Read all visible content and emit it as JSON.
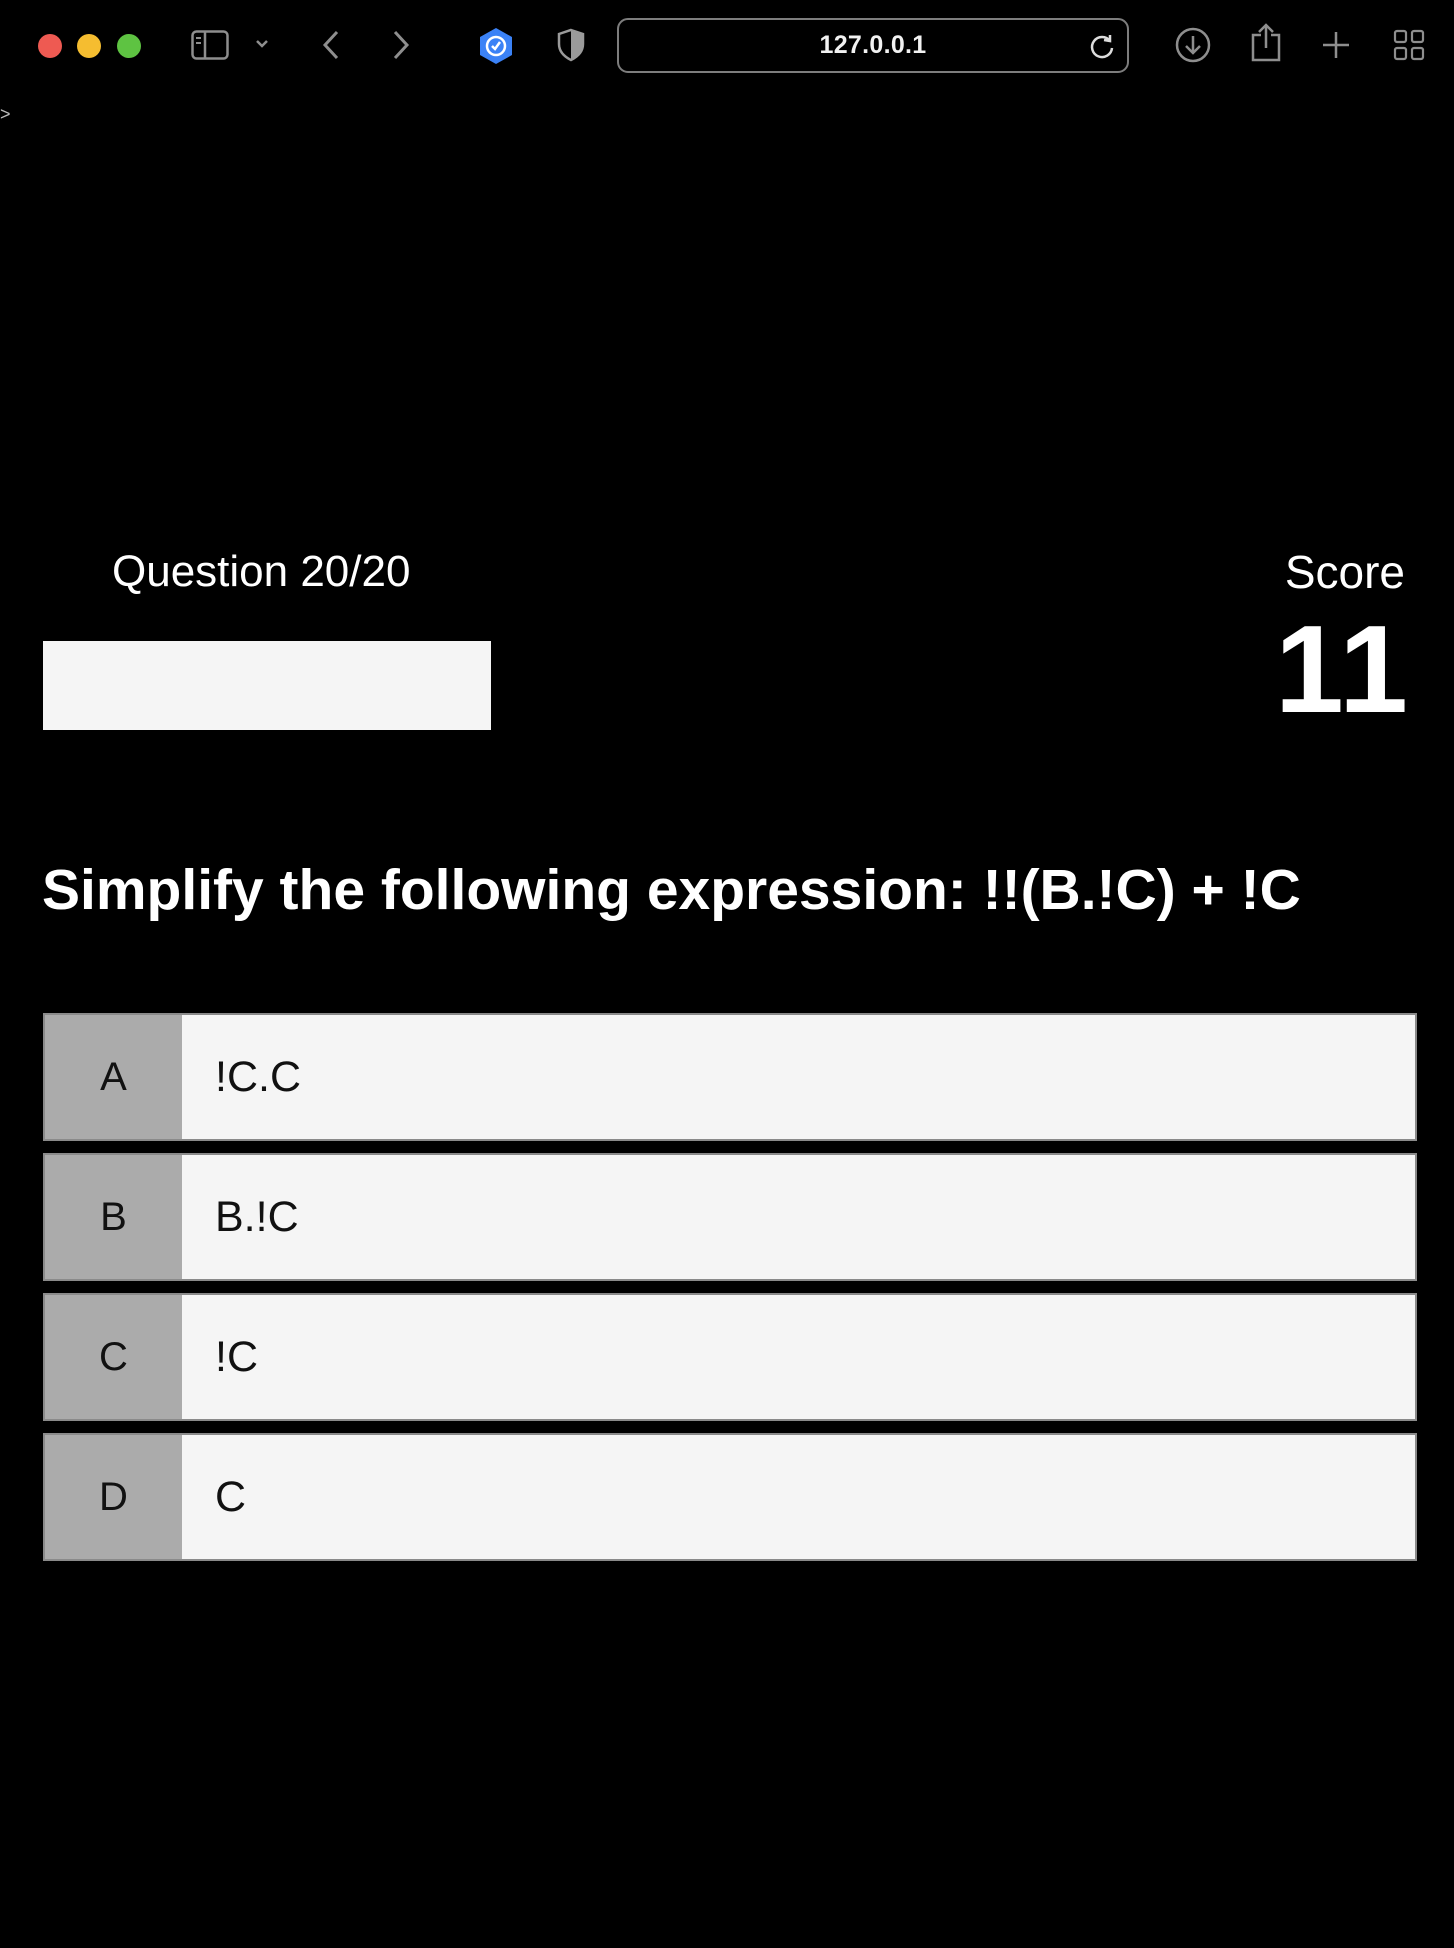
{
  "browser": {
    "url": "127.0.0.1",
    "colors": {
      "close": "#ee5a52",
      "minimize": "#f5bd30",
      "maximize": "#5ec342",
      "shield_accent": "#3b82f6"
    },
    "icons": [
      "sidebar-icon",
      "chevron-down-icon",
      "back-icon",
      "forward-icon",
      "extension-shield-icon",
      "privacy-shield-icon",
      "reload-icon",
      "download-icon",
      "share-icon",
      "new-tab-icon",
      "tab-overview-icon"
    ]
  },
  "page": {
    "caret": ">"
  },
  "quiz": {
    "question_counter": "Question 20/20",
    "progress": 1.0,
    "score_label": "Score",
    "score_value": "11",
    "question": "Simplify the following expression: !!(B.!C) + !C",
    "answers": [
      {
        "letter": "A",
        "text": "!C.C"
      },
      {
        "letter": "B",
        "text": "B.!C"
      },
      {
        "letter": "C",
        "text": "!C"
      },
      {
        "letter": "D",
        "text": "C"
      }
    ]
  }
}
